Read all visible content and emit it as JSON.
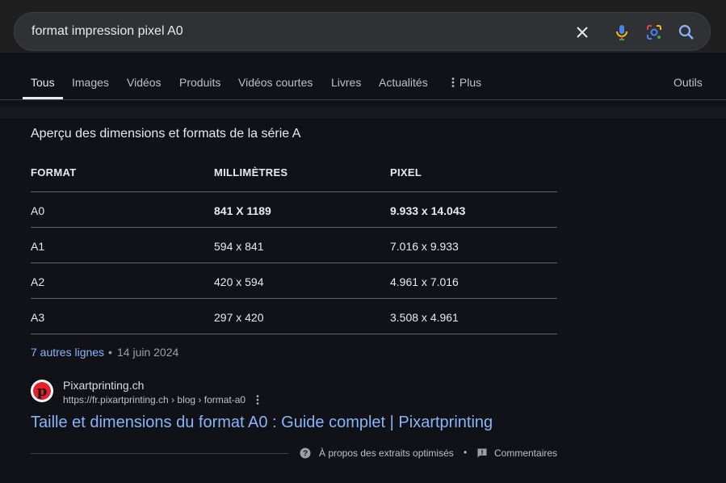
{
  "search": {
    "query": "format impression pixel A0",
    "clear_icon": "close-icon",
    "voice_icon": "microphone-icon",
    "lens_icon": "google-lens-icon",
    "search_icon": "search-icon"
  },
  "tabs": {
    "items": [
      "Tous",
      "Images",
      "Vidéos",
      "Produits",
      "Vidéos courtes",
      "Livres",
      "Actualités",
      "Plus"
    ],
    "active": "Tous",
    "tools": "Outils"
  },
  "snippet": {
    "heading": "Aperçu des dimensions et formats de la série A",
    "columns": [
      "FORMAT",
      "MILLIMÈTRES",
      "PIXEL"
    ],
    "rows": [
      [
        "A0",
        "841 X 1189",
        "9.933 x 14.043"
      ],
      [
        "A1",
        "594 x 841",
        "7.016 x 9.933"
      ],
      [
        "A2",
        "420 x 594",
        "4.961 x 7.016"
      ],
      [
        "A3",
        "297 x 420",
        "3.508 x 4.961"
      ]
    ],
    "more_rows": "7 autres lignes",
    "separator": "•",
    "date": "14 juin 2024"
  },
  "source": {
    "site_name": "Pixartprinting.ch",
    "url": "https://fr.pixartprinting.ch › blog › format-a0",
    "title": "Taille et dimensions du format A0 : Guide complet | Pixartprinting",
    "logo_letter": "p"
  },
  "footer": {
    "about": "À propos des extraits optimisés",
    "separator": "•",
    "feedback": "Commentaires"
  },
  "colors": {
    "link": "#8ab4f8",
    "background": "#101218",
    "searchbar": "#303134"
  }
}
